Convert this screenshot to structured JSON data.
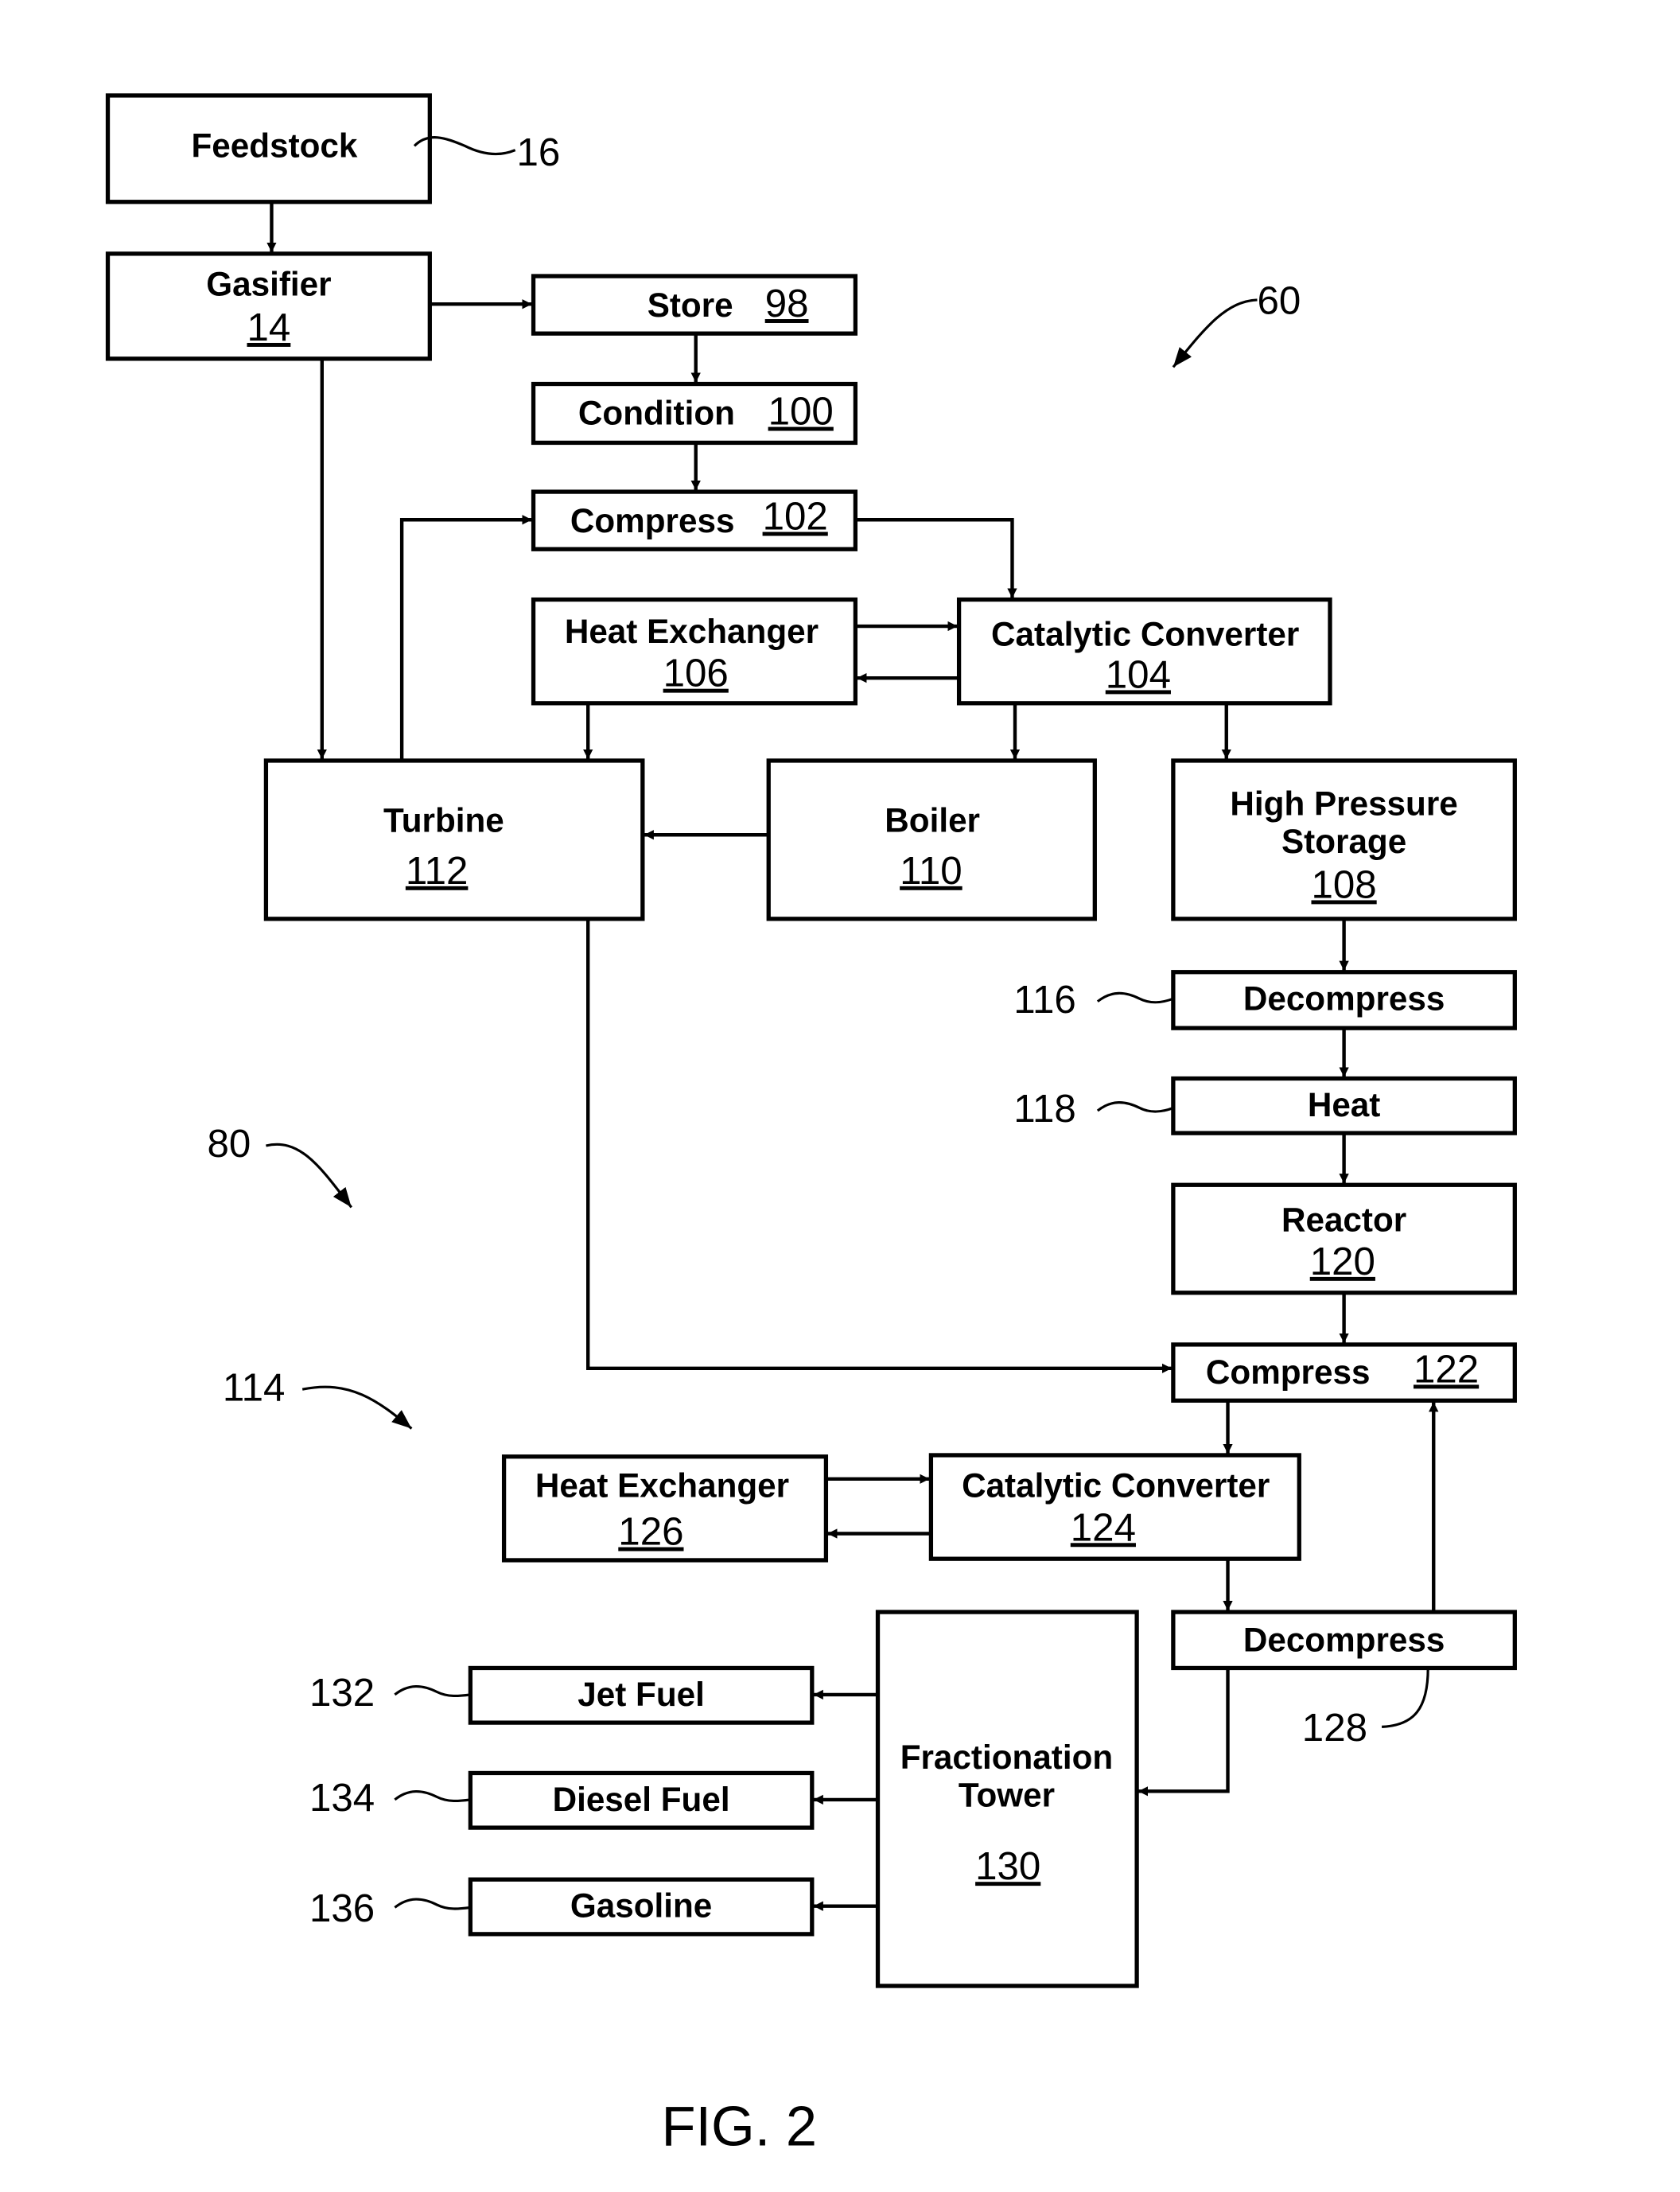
{
  "figure_label": "FIG. 2",
  "reference_labels": {
    "feedstock": "16",
    "system_60": "60",
    "system_80": "80",
    "system_114": "114",
    "decompress_116": "116",
    "heat_118": "118",
    "decompress_128": "128",
    "jet_fuel": "132",
    "diesel_fuel": "134",
    "gasoline": "136"
  },
  "blocks": {
    "feedstock": {
      "label": "Feedstock",
      "number": ""
    },
    "gasifier": {
      "label": "Gasifier",
      "number": "14"
    },
    "store": {
      "label": "Store",
      "number": "98"
    },
    "condition": {
      "label": "Condition",
      "number": "100"
    },
    "compress_102": {
      "label": "Compress",
      "number": "102"
    },
    "heat_exchanger_106": {
      "label": "Heat Exchanger",
      "number": "106"
    },
    "catalytic_converter_104": {
      "label": "Catalytic Converter",
      "number": "104"
    },
    "turbine": {
      "label": "Turbine",
      "number": "112"
    },
    "boiler": {
      "label": "Boiler",
      "number": "110"
    },
    "high_pressure_storage": {
      "label_line1": "High Pressure",
      "label_line2": "Storage",
      "number": "108"
    },
    "decompress_116": {
      "label": "Decompress"
    },
    "heat_118": {
      "label": "Heat"
    },
    "reactor": {
      "label": "Reactor",
      "number": "120"
    },
    "compress_122": {
      "label": "Compress",
      "number": "122"
    },
    "heat_exchanger_126": {
      "label": "Heat Exchanger",
      "number": "126"
    },
    "catalytic_converter_124": {
      "label": "Catalytic Converter",
      "number": "124"
    },
    "decompress_128": {
      "label": "Decompress"
    },
    "fractionation_tower": {
      "label_line1": "Fractionation",
      "label_line2": "Tower",
      "number": "130"
    },
    "jet_fuel": {
      "label": "Jet Fuel"
    },
    "diesel_fuel": {
      "label": "Diesel Fuel"
    },
    "gasoline": {
      "label": "Gasoline"
    }
  }
}
